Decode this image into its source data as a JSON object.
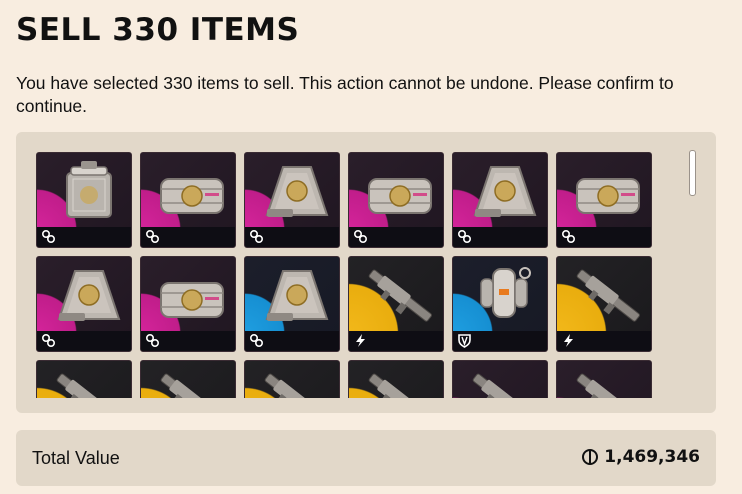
{
  "dialog": {
    "title": "SELL 330 ITEMS",
    "description": "You have selected 330 items to sell. This action cannot be undone. Please confirm to continue."
  },
  "items": [
    {
      "rarity": "magenta",
      "kind": "box",
      "icon": "key-icon"
    },
    {
      "rarity": "magenta",
      "kind": "crate",
      "icon": "key-icon"
    },
    {
      "rarity": "magenta",
      "kind": "prism",
      "icon": "key-icon"
    },
    {
      "rarity": "magenta",
      "kind": "crate",
      "icon": "key-icon"
    },
    {
      "rarity": "magenta",
      "kind": "prism",
      "icon": "key-icon"
    },
    {
      "rarity": "magenta",
      "kind": "crate",
      "icon": "key-icon"
    },
    {
      "rarity": "magenta",
      "kind": "prism",
      "icon": "key-icon"
    },
    {
      "rarity": "magenta",
      "kind": "crate",
      "icon": "key-icon"
    },
    {
      "rarity": "blue",
      "kind": "prism",
      "icon": "key-icon"
    },
    {
      "rarity": "yellow",
      "kind": "weapon",
      "icon": "lightning-icon"
    },
    {
      "rarity": "blue",
      "kind": "jetpack",
      "icon": "shield-icon"
    },
    {
      "rarity": "yellow",
      "kind": "weapon",
      "icon": "lightning-icon"
    },
    {
      "rarity": "yellow",
      "kind": "weapon",
      "icon": ""
    },
    {
      "rarity": "yellow",
      "kind": "weapon",
      "icon": ""
    },
    {
      "rarity": "yellow",
      "kind": "weapon",
      "icon": ""
    },
    {
      "rarity": "yellow",
      "kind": "weapon",
      "icon": ""
    },
    {
      "rarity": "magenta",
      "kind": "weapon",
      "icon": ""
    },
    {
      "rarity": "magenta",
      "kind": "weapon",
      "icon": ""
    }
  ],
  "total": {
    "label": "Total Value",
    "currency_icon": "coin-icon",
    "value": "1,469,346"
  }
}
